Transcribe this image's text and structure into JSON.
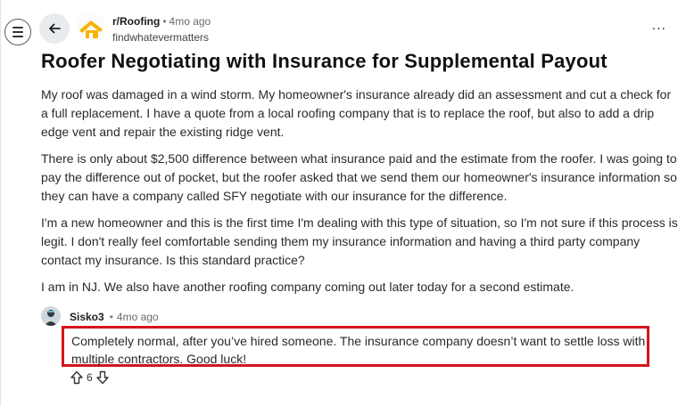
{
  "header": {
    "subreddit": "r/Roofing",
    "separator": "•",
    "age": "4mo ago",
    "author": "findwhatevermatters",
    "more_label": "..."
  },
  "post": {
    "title": "Roofer Negotiating with Insurance for Supplemental Payout",
    "paragraphs": [
      "My roof was damaged in a wind storm. My homeowner's insurance already did an assessment and cut a check for a full replacement. I have a quote from a local roofing company that is to replace the roof, but also to add a drip edge vent and repair the existing ridge vent.",
      "There is only about $2,500 difference between what insurance paid and the estimate from the roofer. I was going to pay the difference out of pocket, but the roofer asked that we send them our homeowner's insurance information so they can have a company called SFY negotiate with our insurance for the difference.",
      "I'm a new homeowner and this is the first time I'm dealing with this type of situation, so I'm not sure if this process is legit. I don't really feel comfortable sending them my insurance information and having a third party company contact my insurance. Is this standard practice?",
      "I am in NJ. We also have another roofing company coming out later today for a second estimate."
    ]
  },
  "comment": {
    "author": "Sisko3",
    "separator": "•",
    "age": "4mo ago",
    "text": "Completely normal, after you’ve hired someone. The insurance company doesn’t want to settle loss with multiple contractors. Good luck!",
    "score": "6"
  },
  "colors": {
    "highlight_border": "#d4151c",
    "subreddit_icon": "#f5b400"
  },
  "icons": [
    "menu-icon",
    "back-arrow-icon",
    "subreddit-icon",
    "more-options-icon",
    "upvote-icon",
    "downvote-icon"
  ]
}
